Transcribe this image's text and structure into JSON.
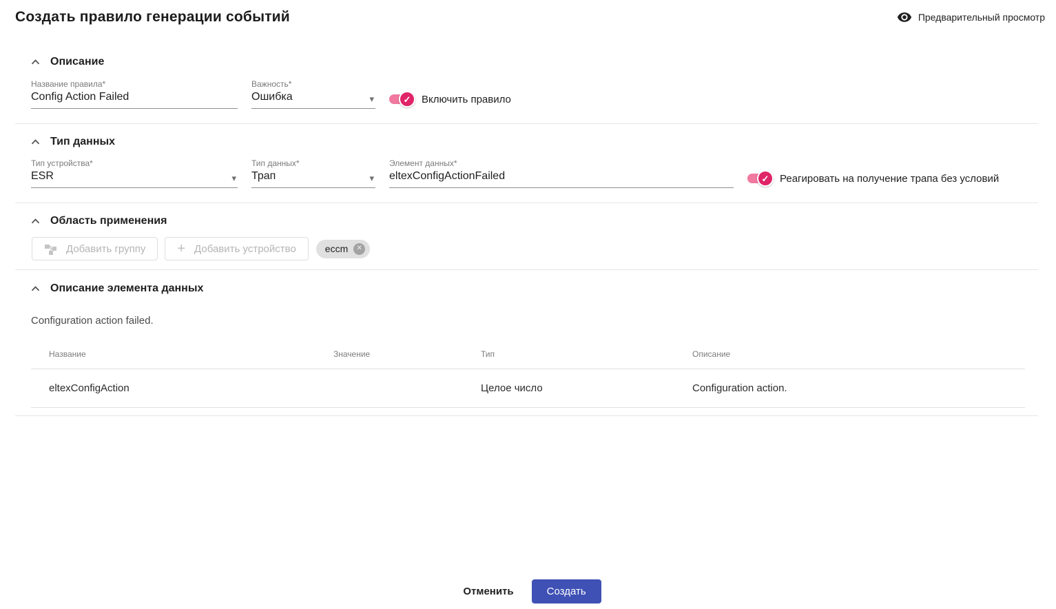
{
  "icons": {
    "caret_down": "▾",
    "plus": "+",
    "check": "✓",
    "close": "✕"
  },
  "colors": {
    "accent_pink": "#e02468",
    "accent_pink_track": "#f1789f",
    "primary_button": "#3f51b5"
  },
  "header": {
    "title": "Создать правило генерации событий",
    "preview_label": "Предварительный просмотр"
  },
  "description_section": {
    "title": "Описание",
    "rule_name": {
      "label": "Название правила*",
      "value": "Config Action Failed"
    },
    "severity": {
      "label": "Важность*",
      "value": "Ошибка"
    },
    "enable_toggle": {
      "label": "Включить правило",
      "on": true
    }
  },
  "data_type_section": {
    "title": "Тип данных",
    "device_type": {
      "label": "Тип устройства*",
      "value": "ESR"
    },
    "data_type": {
      "label": "Тип данных*",
      "value": "Трап"
    },
    "data_element": {
      "label": "Элемент данных*",
      "value": "eltexConfigActionFailed"
    },
    "trap_toggle": {
      "label": "Реагировать на получение трапа без условий",
      "on": true
    }
  },
  "scope_section": {
    "title": "Область применения",
    "add_group_label": "Добавить группу",
    "add_device_label": "Добавить устройство",
    "chips": [
      {
        "label": "eccm"
      }
    ]
  },
  "element_description_section": {
    "title": "Описание элемента данных",
    "description": "Configuration action failed.",
    "table": {
      "headers": [
        "Название",
        "Значение",
        "Тип",
        "Описание"
      ],
      "rows": [
        {
          "name": "eltexConfigAction",
          "value": "",
          "type": "Целое число",
          "description": "Configuration action."
        }
      ]
    }
  },
  "footer": {
    "cancel_label": "Отменить",
    "create_label": "Создать"
  }
}
